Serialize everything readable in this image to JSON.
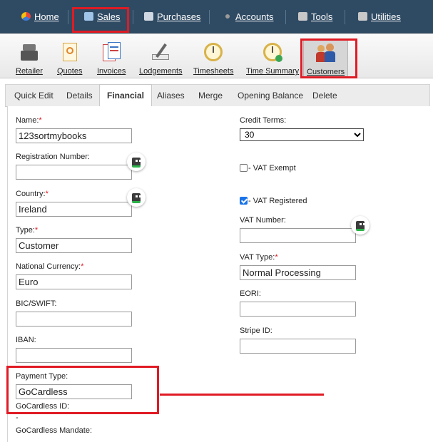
{
  "menu": {
    "items": [
      {
        "label": "Home",
        "icon": "home-icon",
        "color": "#e8453c"
      },
      {
        "label": "Sales",
        "icon": "sales-icon",
        "color": "#6fa8dc"
      },
      {
        "label": "Purchases",
        "icon": "purchases-icon",
        "color": "#cfd8e3"
      },
      {
        "label": "Accounts",
        "icon": "accounts-icon",
        "color": "#c0c0c0"
      },
      {
        "label": "Tools",
        "icon": "tools-icon",
        "color": "#c8c8c8"
      },
      {
        "label": "Utilities",
        "icon": "utilities-icon",
        "color": "#c8c8c8"
      }
    ]
  },
  "toolbar": {
    "items": [
      {
        "label": "Retailer",
        "icon": "cash-register-icon"
      },
      {
        "label": "Quotes",
        "icon": "quote-document-icon"
      },
      {
        "label": "Invoices",
        "icon": "invoice-document-icon"
      },
      {
        "label": "Lodgements",
        "icon": "lodgement-pen-icon"
      },
      {
        "label": "Timesheets",
        "icon": "clock-icon"
      },
      {
        "label": "Time Summary",
        "icon": "clock-summary-icon"
      },
      {
        "label": "Customers",
        "icon": "customers-people-icon"
      }
    ]
  },
  "tabs": [
    "Quick Edit",
    "Details",
    "Financial",
    "Aliases",
    "Merge",
    "Opening Balance",
    "Delete"
  ],
  "form": {
    "name": {
      "label": "Name:",
      "required": "*",
      "value": "123sortmybooks"
    },
    "registration": {
      "label": "Registration Number:",
      "value": ""
    },
    "country": {
      "label": "Country:",
      "required": "*",
      "value": "Ireland"
    },
    "type": {
      "label": "Type:",
      "required": "*",
      "value": "Customer"
    },
    "currency": {
      "label": "National Currency:",
      "required": "*",
      "value": "Euro"
    },
    "bic": {
      "label": "BIC/SWIFT:",
      "value": ""
    },
    "iban": {
      "label": "IBAN:",
      "value": ""
    },
    "payment_type": {
      "label": "Payment Type:",
      "value": "GoCardless"
    },
    "gocardless_id": {
      "label": "GoCardless ID:",
      "value": "-"
    },
    "gocardless_mandate": {
      "label": "GoCardless Mandate:"
    },
    "credit_terms": {
      "label": "Credit Terms:",
      "value": "30"
    },
    "vat_exempt": {
      "label": " - VAT Exempt",
      "checked": false
    },
    "vat_registered": {
      "label": " - VAT Registered",
      "checked": true
    },
    "vat_number": {
      "label": "VAT Number:",
      "value": ""
    },
    "vat_type": {
      "label": "VAT Type:",
      "required": "*",
      "value": "Normal Processing"
    },
    "eori": {
      "label": "EORI:",
      "value": ""
    },
    "stripe_id": {
      "label": "Stripe ID:",
      "value": ""
    }
  },
  "colors": {
    "menubar": "#2f4a63",
    "highlight": "#e01b24",
    "checkbox": "#1a73e8"
  }
}
